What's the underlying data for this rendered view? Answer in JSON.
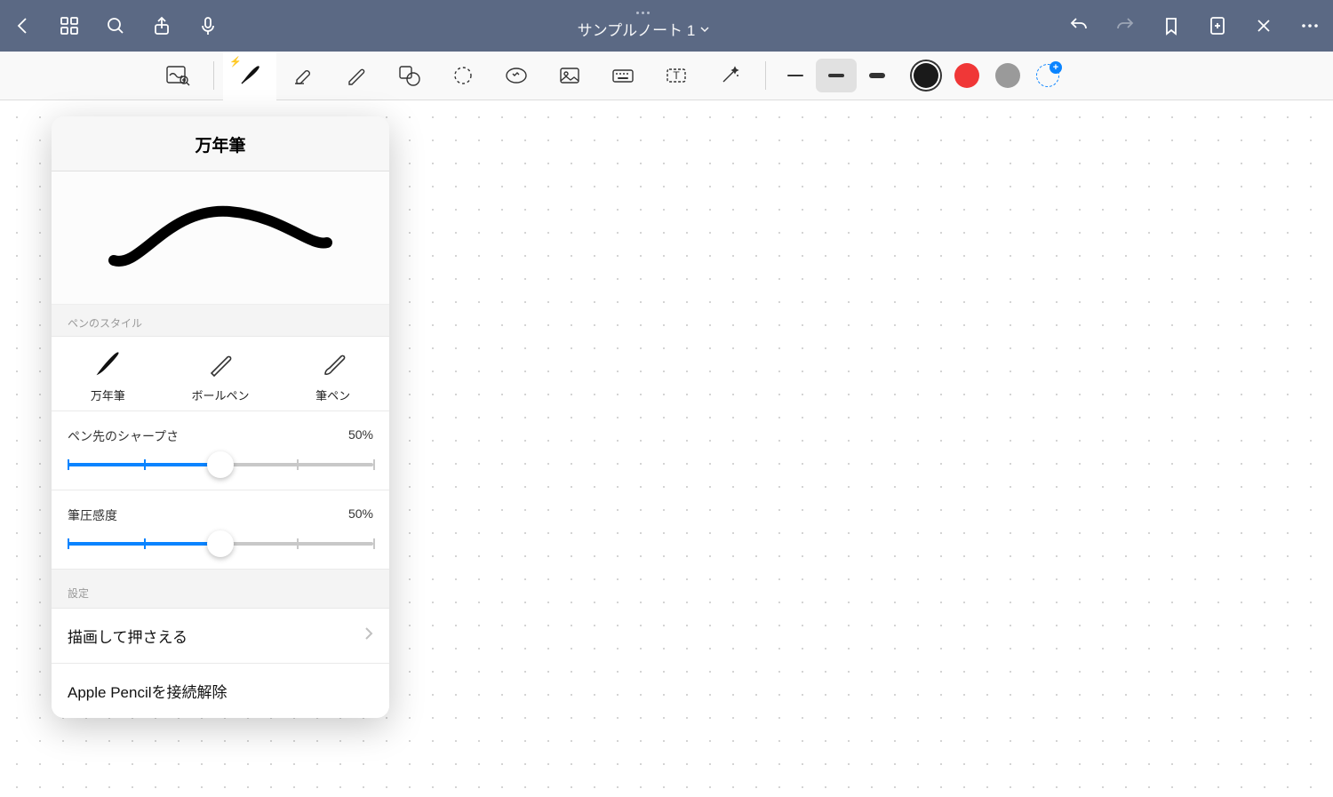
{
  "header": {
    "document_title": "サンプルノート 1"
  },
  "toolbar": {
    "colors": {
      "black": "#1a1a1a",
      "red": "#f03737",
      "grey": "#9a9a9a"
    }
  },
  "popover": {
    "title": "万年筆",
    "style_section_label": "ペンのスタイル",
    "styles": {
      "fountain": "万年筆",
      "ballpoint": "ボールペン",
      "brush": "筆ペン"
    },
    "sharpness_label": "ペン先のシャープさ",
    "sharpness_value": "50%",
    "sharpness_percent": 50,
    "pressure_label": "筆圧感度",
    "pressure_value": "50%",
    "pressure_percent": 50,
    "settings_label": "設定",
    "row_draw_hold": "描画して押さえる",
    "row_disconnect": "Apple Pencilを接続解除"
  }
}
